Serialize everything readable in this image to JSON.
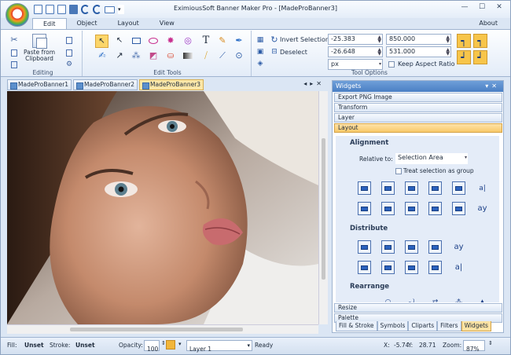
{
  "window": {
    "title": "EximiousSoft Banner Maker Pro - [MadeProBanner3]",
    "controls": [
      "—",
      "☐",
      "✕"
    ]
  },
  "menu_tabs": [
    "Edit",
    "Object",
    "Layout",
    "View"
  ],
  "about_label": "About",
  "ribbon": {
    "editing": {
      "paste_label": "Paste from Clipboard",
      "group_label": "Editing"
    },
    "edit_tools": {
      "group_label": "Edit Tools"
    },
    "tool_options": {
      "group_label": "Tool Options",
      "invert_selection": "Invert Selection",
      "deselect": "Deselect",
      "x_value": "-25.383",
      "y_value": "-26.648",
      "unit": "px",
      "width_value": "850.000",
      "height_value": "531.000",
      "keep_aspect": "Keep Aspect Ratio"
    }
  },
  "doc_tabs": [
    "MadeProBanner1",
    "MadeProBanner2",
    "MadeProBanner3"
  ],
  "active_doc_tab": 2,
  "panel": {
    "title": "Widgets",
    "sections_top": [
      "Export PNG Image",
      "Transform",
      "Layer",
      "Layout"
    ],
    "alignment_label": "Alignment",
    "relative_to_label": "Relative to:",
    "relative_to_value": "Selection Area",
    "treat_label": "Treat selection as group",
    "distribute_label": "Distribute",
    "rearrange_label": "Rearrange",
    "sections_bottom": [
      "Resize",
      "Palette"
    ],
    "tabs": [
      "Fill & Stroke",
      "Symbols",
      "Cliparts",
      "Filters",
      "Widgets"
    ],
    "active_tab": 4
  },
  "status": {
    "fill_label": "Fill:",
    "fill_value": "Unset",
    "stroke_label": "Stroke:",
    "stroke_value": "Unset",
    "opacity_label": "Opacity:",
    "opacity_value": "100",
    "layer_value": "Layer 1",
    "ready": "Ready",
    "x_label": "X:",
    "x_value": "-5.74",
    "y_label": "Y:",
    "y_value": "28.71",
    "zoom_label": "Zoom:",
    "zoom_value": "87%"
  },
  "colors": {
    "accent": "#f7c54a",
    "panel_header": "#4a7fc4",
    "chrome": "#dbe6f4"
  }
}
